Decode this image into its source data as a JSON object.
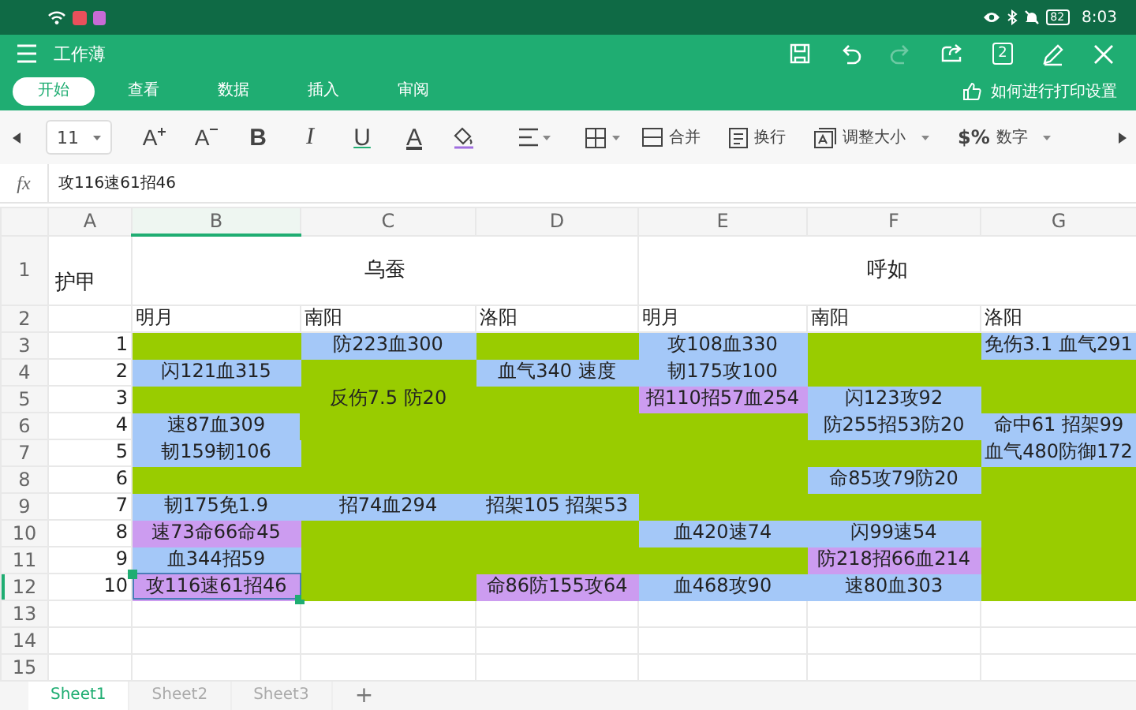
{
  "status_bar": {
    "battery": "82",
    "time": "8:03"
  },
  "app_bar": {
    "title": "工作薄",
    "actions": [
      {
        "kind": "save",
        "disabled": false
      },
      {
        "kind": "undo",
        "disabled": false
      },
      {
        "kind": "redo",
        "disabled": true
      },
      {
        "kind": "share",
        "disabled": false
      },
      {
        "kind": "pages",
        "label": "2",
        "disabled": false
      },
      {
        "kind": "edit",
        "disabled": false
      },
      {
        "kind": "close",
        "disabled": false
      }
    ]
  },
  "ribbon_tabs": [
    {
      "label": "开始",
      "selected": true
    },
    {
      "label": "查看",
      "selected": false
    },
    {
      "label": "数据",
      "selected": false
    },
    {
      "label": "插入",
      "selected": false
    },
    {
      "label": "审阅",
      "selected": false
    }
  ],
  "help_link": "如何进行打印设置",
  "toolbar": [
    {
      "kind": "prev"
    },
    {
      "kind": "font-size",
      "label": "11"
    },
    {
      "kind": "grow-font",
      "glyph": "A"
    },
    {
      "kind": "shrink-font",
      "glyph": "A"
    },
    {
      "kind": "bold",
      "glyph": "B"
    },
    {
      "kind": "italic",
      "glyph": "I"
    },
    {
      "kind": "underline",
      "glyph": "U"
    },
    {
      "kind": "font-color",
      "glyph": "A"
    },
    {
      "kind": "fill"
    },
    {
      "kind": "align"
    },
    {
      "kind": "borders"
    },
    {
      "kind": "merge",
      "label": "合并"
    },
    {
      "kind": "wrap",
      "label": "换行"
    },
    {
      "kind": "resize",
      "label": "调整大小"
    },
    {
      "kind": "number-format",
      "glyph": "$%",
      "label": "数字"
    },
    {
      "kind": "next"
    }
  ],
  "formula_bar": {
    "label": "fx",
    "value": "攻116速61招46"
  },
  "sheet": {
    "columns": [
      {
        "label": "A",
        "selected": false
      },
      {
        "label": "B",
        "selected": true
      },
      {
        "label": "C",
        "selected": false
      },
      {
        "label": "D",
        "selected": false
      },
      {
        "label": "E",
        "selected": false
      },
      {
        "label": "F",
        "selected": false
      },
      {
        "label": "G",
        "selected": false
      }
    ],
    "rows": [
      {
        "number": "1",
        "selected": false,
        "cells": [
          {
            "kind": "label",
            "text": "护甲",
            "selected": false
          },
          {
            "kind": "group",
            "text": "乌蚕",
            "selected": false
          },
          {
            "kind": "group",
            "text": "呼如",
            "selected": false
          }
        ]
      },
      {
        "number": "2",
        "selected": false,
        "cells": [
          {
            "kind": "label",
            "selected": false
          },
          {
            "kind": "label",
            "text": "明月",
            "selected": false
          },
          {
            "kind": "label",
            "text": "南阳",
            "selected": false
          },
          {
            "kind": "label",
            "text": "洛阳",
            "selected": false
          },
          {
            "kind": "label",
            "text": "明月",
            "selected": false
          },
          {
            "kind": "label",
            "text": "南阳",
            "selected": false
          },
          {
            "kind": "label",
            "text": "洛阳",
            "selected": false
          }
        ]
      },
      {
        "number": "3",
        "selected": false,
        "cells": [
          {
            "kind": "index",
            "text": "1",
            "selected": false
          },
          {
            "kind": "value",
            "color": "#99cc00",
            "selected": false
          },
          {
            "kind": "value",
            "text": "防223血300",
            "color": "#a4c8f8",
            "selected": false
          },
          {
            "kind": "value",
            "color": "#99cc00",
            "selected": false
          },
          {
            "kind": "value",
            "text": "攻108血330",
            "color": "#a4c8f8",
            "selected": false
          },
          {
            "kind": "value",
            "color": "#99cc00",
            "selected": false
          },
          {
            "kind": "value",
            "text": "免伤3.1 血气291",
            "color": "#a4c8f8",
            "selected": false
          }
        ]
      },
      {
        "number": "4",
        "selected": false,
        "cells": [
          {
            "kind": "index",
            "text": "2",
            "selected": false
          },
          {
            "kind": "value",
            "text": "闪121血315",
            "color": "#a4c8f8",
            "selected": false
          },
          {
            "kind": "block",
            "text": "反伤7.5 防20",
            "color": "#99cc00",
            "selected": false
          },
          {
            "kind": "value",
            "text": "血气340 速度",
            "color": "#a4c8f8",
            "selected": false
          },
          {
            "kind": "value",
            "text": "韧175攻100",
            "color": "#a4c8f8",
            "selected": false
          },
          {
            "kind": "value",
            "color": "#99cc00",
            "selected": false
          },
          {
            "kind": "value",
            "color": "#99cc00",
            "selected": false
          }
        ]
      },
      {
        "number": "5",
        "selected": false,
        "cells": [
          {
            "kind": "index",
            "text": "3",
            "selected": false
          },
          {
            "kind": "value",
            "color": "#99cc00",
            "selected": false
          },
          {
            "kind": "value",
            "color": "#99cc00",
            "selected": false
          },
          {
            "kind": "value",
            "text": "招110招57血254",
            "color": "#cc9cf0",
            "selected": false
          },
          {
            "kind": "value",
            "text": "闪123攻92",
            "color": "#a4c8f8",
            "selected": false
          },
          {
            "kind": "value",
            "color": "#99cc00",
            "selected": false
          }
        ]
      },
      {
        "number": "6",
        "selected": false,
        "cells": [
          {
            "kind": "index",
            "text": "4",
            "selected": false
          },
          {
            "kind": "value",
            "text": "速87血309",
            "color": "#a4c8f8",
            "selected": false
          },
          {
            "kind": "value",
            "color": "#99cc00",
            "selected": false
          },
          {
            "kind": "value",
            "color": "#99cc00",
            "selected": false
          },
          {
            "kind": "value",
            "text": "防255招53防20",
            "color": "#a4c8f8",
            "selected": false
          },
          {
            "kind": "value",
            "text": "命中61 招架99",
            "color": "#a4c8f8",
            "selected": false
          }
        ]
      },
      {
        "number": "7",
        "selected": false,
        "cells": [
          {
            "kind": "index",
            "text": "5",
            "selected": false
          },
          {
            "kind": "value",
            "text": "韧159韧106",
            "color": "#a4c8f8",
            "selected": false
          },
          {
            "kind": "value",
            "color": "#99cc00",
            "selected": false
          },
          {
            "kind": "value",
            "color": "#99cc00",
            "selected": false
          },
          {
            "kind": "value",
            "color": "#99cc00",
            "selected": false
          },
          {
            "kind": "value",
            "color": "#99cc00",
            "selected": false
          },
          {
            "kind": "value",
            "text": "血气480防御172",
            "color": "#a4c8f8",
            "selected": false
          }
        ]
      },
      {
        "number": "8",
        "selected": false,
        "cells": [
          {
            "kind": "index",
            "text": "6",
            "selected": false
          },
          {
            "kind": "value",
            "color": "#99cc00",
            "selected": false
          },
          {
            "kind": "value",
            "color": "#99cc00",
            "selected": false
          },
          {
            "kind": "value",
            "color": "#99cc00",
            "selected": false
          },
          {
            "kind": "value",
            "color": "#99cc00",
            "selected": false
          },
          {
            "kind": "value",
            "text": "命85攻79防20",
            "color": "#a4c8f8",
            "selected": false
          },
          {
            "kind": "value",
            "color": "#99cc00",
            "selected": false
          }
        ]
      },
      {
        "number": "9",
        "selected": false,
        "cells": [
          {
            "kind": "index",
            "text": "7",
            "selected": false
          },
          {
            "kind": "value",
            "text": "韧175免1.9",
            "color": "#a4c8f8",
            "selected": false
          },
          {
            "kind": "value",
            "text": "招74血294",
            "color": "#a4c8f8",
            "selected": false
          },
          {
            "kind": "value",
            "text": "招架105 招架53",
            "color": "#a4c8f8",
            "selected": false
          },
          {
            "kind": "value",
            "color": "#99cc00",
            "selected": false
          },
          {
            "kind": "value",
            "color": "#99cc00",
            "selected": false
          },
          {
            "kind": "value",
            "color": "#99cc00",
            "selected": false
          }
        ]
      },
      {
        "number": "10",
        "selected": false,
        "cells": [
          {
            "kind": "index",
            "text": "8",
            "selected": false
          },
          {
            "kind": "value",
            "text": "速73命66命45",
            "color": "#cc9cf0",
            "selected": false
          },
          {
            "kind": "value",
            "color": "#99cc00",
            "selected": false
          },
          {
            "kind": "value",
            "color": "#99cc00",
            "selected": false
          },
          {
            "kind": "value",
            "text": "血420速74",
            "color": "#a4c8f8",
            "selected": false
          },
          {
            "kind": "value",
            "text": "闪99速54",
            "color": "#a4c8f8",
            "selected": false
          },
          {
            "kind": "value",
            "color": "#99cc00",
            "selected": false
          }
        ]
      },
      {
        "number": "11",
        "selected": false,
        "cells": [
          {
            "kind": "index",
            "text": "9",
            "selected": false
          },
          {
            "kind": "value",
            "text": "血344招59",
            "color": "#a4c8f8",
            "selected": false
          },
          {
            "kind": "value",
            "color": "#99cc00",
            "selected": false
          },
          {
            "kind": "value",
            "color": "#99cc00",
            "selected": false
          },
          {
            "kind": "value",
            "color": "#99cc00",
            "selected": false
          },
          {
            "kind": "value",
            "text": "防218招66血214",
            "color": "#cc9cf0",
            "selected": false
          },
          {
            "kind": "value",
            "color": "#99cc00",
            "selected": false
          }
        ]
      },
      {
        "number": "12",
        "selected": true,
        "cells": [
          {
            "kind": "index",
            "text": "10",
            "selected": false
          },
          {
            "kind": "value",
            "text": "攻116速61招46",
            "color": "#cc9cf0",
            "selected": true
          },
          {
            "kind": "value",
            "color": "#99cc00",
            "selected": false
          },
          {
            "kind": "value",
            "text": "命86防155攻64",
            "color": "#cc9cf0",
            "selected": false
          },
          {
            "kind": "value",
            "text": "血468攻90",
            "color": "#a4c8f8",
            "selected": false
          },
          {
            "kind": "value",
            "text": "速80血303",
            "color": "#a4c8f8",
            "selected": false
          },
          {
            "kind": "value",
            "color": "#99cc00",
            "selected": false
          }
        ]
      },
      {
        "number": "13",
        "selected": false
      },
      {
        "number": "14",
        "selected": false
      },
      {
        "number": "15",
        "selected": false
      }
    ]
  },
  "sheet_tabs": [
    {
      "label": "Sheet1",
      "selected": true
    },
    {
      "label": "Sheet2",
      "selected": false
    },
    {
      "label": "Sheet3",
      "selected": false
    }
  ],
  "add_sheet": "+"
}
